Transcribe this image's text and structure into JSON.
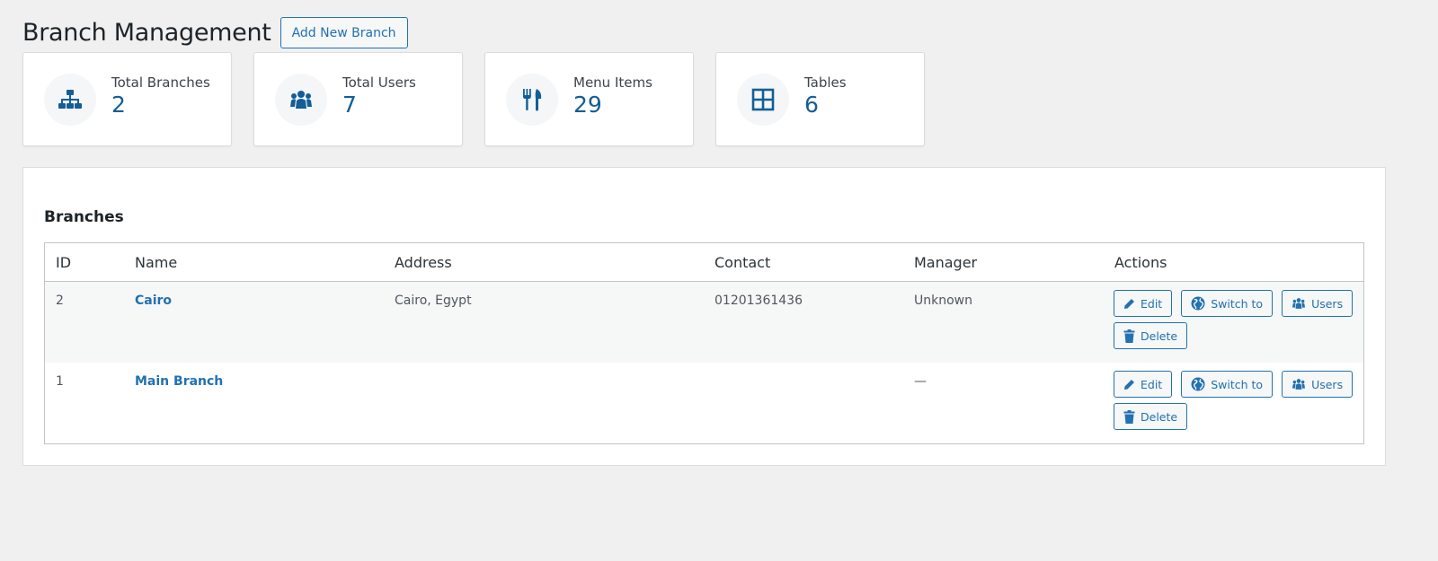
{
  "header": {
    "title": "Branch Management",
    "add_button": "Add New Branch"
  },
  "stats": [
    {
      "label": "Total Branches",
      "value": "2",
      "icon": "sitemap-icon"
    },
    {
      "label": "Total Users",
      "value": "7",
      "icon": "users-icon"
    },
    {
      "label": "Menu Items",
      "value": "29",
      "icon": "utensils-icon"
    },
    {
      "label": "Tables",
      "value": "6",
      "icon": "grid-icon"
    }
  ],
  "branches": {
    "title": "Branches",
    "columns": [
      "ID",
      "Name",
      "Address",
      "Contact",
      "Manager",
      "Actions"
    ],
    "rows": [
      {
        "id": "2",
        "name": "Cairo",
        "address": "Cairo, Egypt",
        "contact": "01201361436",
        "manager": "Unknown"
      },
      {
        "id": "1",
        "name": "Main Branch",
        "address": "",
        "contact": "",
        "manager": "—"
      }
    ],
    "actions": {
      "edit": "Edit",
      "switch": "Switch to",
      "users": "Users",
      "delete": "Delete"
    }
  },
  "colors": {
    "accent": "#2271b1",
    "stat_value": "#135e96",
    "background": "#f0f0f1"
  }
}
